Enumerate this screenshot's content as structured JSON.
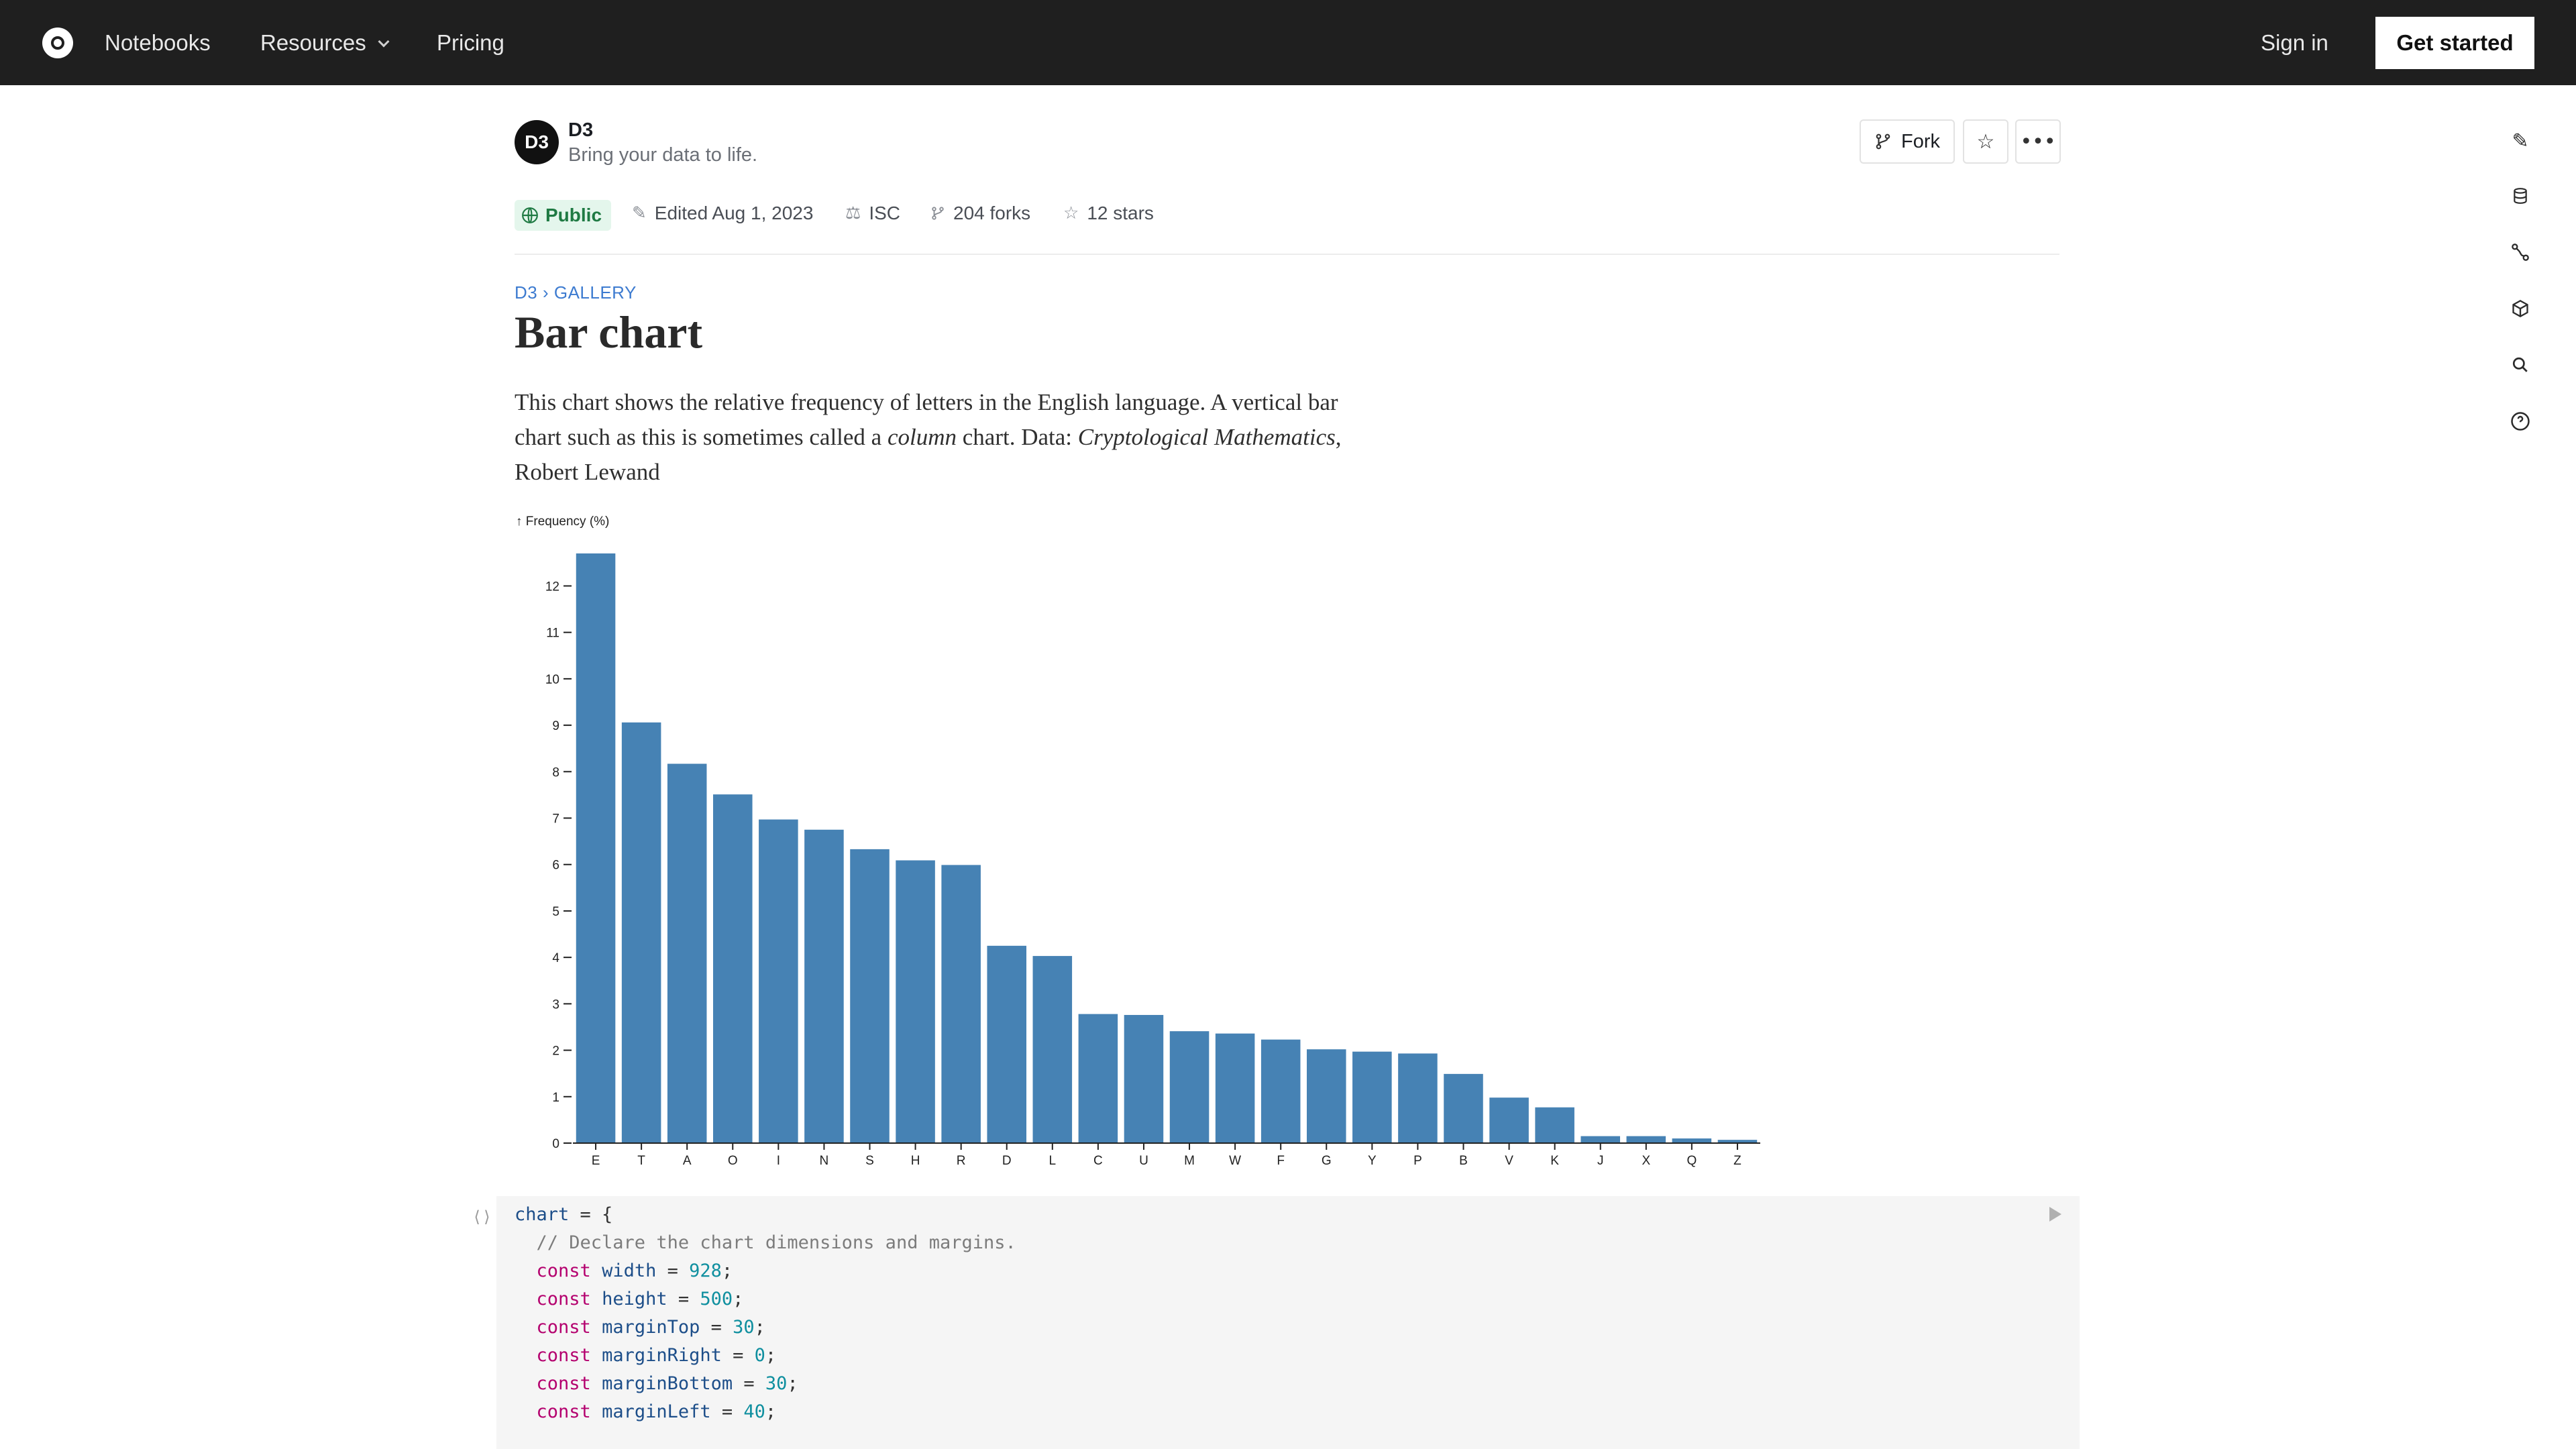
{
  "nav": {
    "notebooks": "Notebooks",
    "resources": "Resources",
    "pricing": "Pricing",
    "sign_in": "Sign in",
    "get_started": "Get started"
  },
  "notebook": {
    "owner": {
      "name": "D3",
      "tagline": "Bring your data to life.",
      "avatar_text": "D3"
    },
    "actions": {
      "fork": "Fork"
    },
    "meta": {
      "visibility": "Public",
      "edited": "Edited Aug 1, 2023",
      "license": "ISC",
      "forks": "204 forks",
      "stars": "12 stars"
    }
  },
  "article": {
    "breadcrumb": "D3 › GALLERY",
    "title": "Bar chart",
    "description_parts": [
      "This chart shows the relative frequency of letters in the English language. A vertical bar chart such as this is sometimes called a ",
      "column",
      " chart. Data: ",
      "Cryptological Mathematics",
      ", Robert Lewand"
    ]
  },
  "chart_data": {
    "type": "bar",
    "ylabel": "↑ Frequency (%)",
    "categories": [
      "E",
      "T",
      "A",
      "O",
      "I",
      "N",
      "S",
      "H",
      "R",
      "D",
      "L",
      "C",
      "U",
      "M",
      "W",
      "F",
      "G",
      "Y",
      "P",
      "B",
      "V",
      "K",
      "J",
      "X",
      "Q",
      "Z"
    ],
    "values": [
      12.7,
      9.06,
      8.17,
      7.51,
      6.97,
      6.75,
      6.33,
      6.09,
      5.99,
      4.25,
      4.03,
      2.78,
      2.76,
      2.41,
      2.36,
      2.23,
      2.02,
      1.97,
      1.93,
      1.49,
      0.98,
      0.77,
      0.15,
      0.15,
      0.1,
      0.07
    ],
    "ylim": [
      0,
      12.7
    ],
    "yticks": [
      0,
      1,
      2,
      3,
      4,
      5,
      6,
      7,
      8,
      9,
      10,
      11,
      12
    ],
    "color": "#4682b4"
  },
  "code": {
    "lines": [
      "chart = {",
      "  // Declare the chart dimensions and margins.",
      "  const width = 928;",
      "  const height = 500;",
      "  const marginTop = 30;",
      "  const marginRight = 0;",
      "  const marginBottom = 30;",
      "  const marginLeft = 40;"
    ]
  },
  "sidebar": {
    "icons": [
      "paint-icon",
      "database-icon",
      "dependency-icon",
      "package-icon",
      "search-icon",
      "help-icon"
    ]
  }
}
